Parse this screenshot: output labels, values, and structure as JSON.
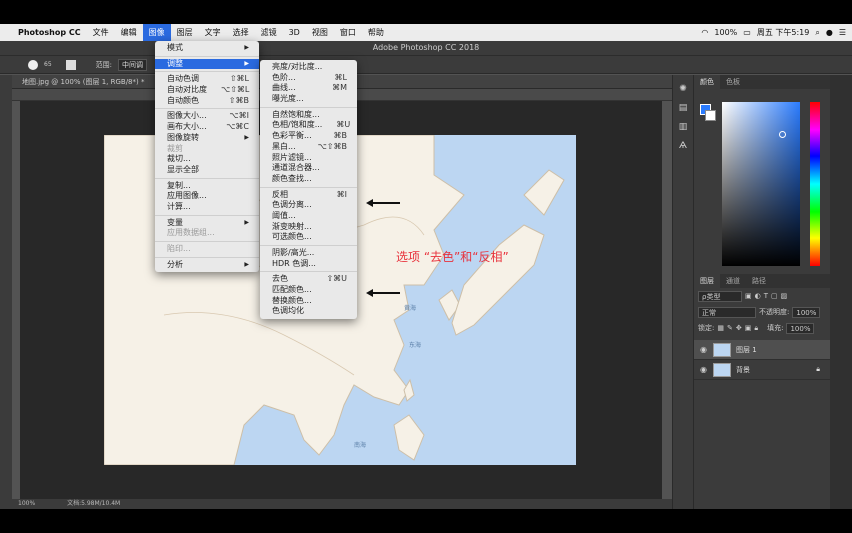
{
  "macmenu": {
    "apple": "",
    "app": "Photoshop CC",
    "items": [
      "文件",
      "编辑",
      "图像",
      "图层",
      "文字",
      "选择",
      "滤镜",
      "3D",
      "视图",
      "窗口",
      "帮助"
    ],
    "battery": "100%",
    "clock": "周五 下午5:19"
  },
  "window_title": "Adobe Photoshop CC 2018",
  "options": {
    "size": "65",
    "range_label": "范围:",
    "range_value": "中间调"
  },
  "doc_tab": "地图.jpg @ 100% (图层 1, RGB/8*) *",
  "status": {
    "zoom": "100%",
    "doc": "文档:5.98M/10.4M"
  },
  "image_menu": [
    {
      "label": "模式",
      "arrow": true
    },
    {
      "sep": true
    },
    {
      "label": "调整",
      "arrow": true,
      "hl": true
    },
    {
      "sep": true
    },
    {
      "label": "自动色调",
      "sc": "⇧⌘L"
    },
    {
      "label": "自动对比度",
      "sc": "⌥⇧⌘L"
    },
    {
      "label": "自动颜色",
      "sc": "⇧⌘B"
    },
    {
      "sep": true
    },
    {
      "label": "图像大小...",
      "sc": "⌥⌘I"
    },
    {
      "label": "画布大小...",
      "sc": "⌥⌘C"
    },
    {
      "label": "图像旋转",
      "arrow": true
    },
    {
      "label": "裁剪",
      "dis": true
    },
    {
      "label": "裁切..."
    },
    {
      "label": "显示全部"
    },
    {
      "sep": true
    },
    {
      "label": "复制..."
    },
    {
      "label": "应用图像..."
    },
    {
      "label": "计算..."
    },
    {
      "sep": true
    },
    {
      "label": "变量",
      "arrow": true
    },
    {
      "label": "应用数据组...",
      "dis": true
    },
    {
      "sep": true
    },
    {
      "label": "陷印...",
      "dis": true
    },
    {
      "sep": true
    },
    {
      "label": "分析",
      "arrow": true
    }
  ],
  "adjust_menu": [
    {
      "label": "亮度/对比度..."
    },
    {
      "label": "色阶...",
      "sc": "⌘L"
    },
    {
      "label": "曲线...",
      "sc": "⌘M"
    },
    {
      "label": "曝光度..."
    },
    {
      "sep": true
    },
    {
      "label": "自然饱和度..."
    },
    {
      "label": "色相/饱和度...",
      "sc": "⌘U"
    },
    {
      "label": "色彩平衡...",
      "sc": "⌘B"
    },
    {
      "label": "黑白...",
      "sc": "⌥⇧⌘B"
    },
    {
      "label": "照片滤镜..."
    },
    {
      "label": "通道混合器..."
    },
    {
      "label": "颜色查找..."
    },
    {
      "sep": true
    },
    {
      "label": "反相",
      "sc": "⌘I"
    },
    {
      "label": "色调分离..."
    },
    {
      "label": "阈值..."
    },
    {
      "label": "渐变映射..."
    },
    {
      "label": "可选颜色..."
    },
    {
      "sep": true
    },
    {
      "label": "阴影/高光..."
    },
    {
      "label": "HDR 色调..."
    },
    {
      "sep": true
    },
    {
      "label": "去色",
      "sc": "⇧⌘U"
    },
    {
      "label": "匹配颜色..."
    },
    {
      "label": "替换颜色..."
    },
    {
      "label": "色调均化"
    }
  ],
  "annotation": "选项 “去色”和“反相”",
  "color_panel": {
    "tabs": [
      "颜色",
      "色板"
    ],
    "fg": "#2b7cff",
    "bg": "#ffffff"
  },
  "layers_panel": {
    "tabs": [
      "图层",
      "通道",
      "路径"
    ],
    "filter": "ρ类型",
    "blend": "正常",
    "opacity_label": "不透明度:",
    "opacity": "100%",
    "lock_label": "锁定:",
    "fill_label": "填充:",
    "fill": "100%",
    "layers": [
      {
        "name": "图层 1",
        "active": true
      },
      {
        "name": "背景",
        "active": false
      }
    ]
  },
  "map_labels": {
    "sea1": "黄海",
    "sea2": "东海",
    "sea3": "南海"
  }
}
